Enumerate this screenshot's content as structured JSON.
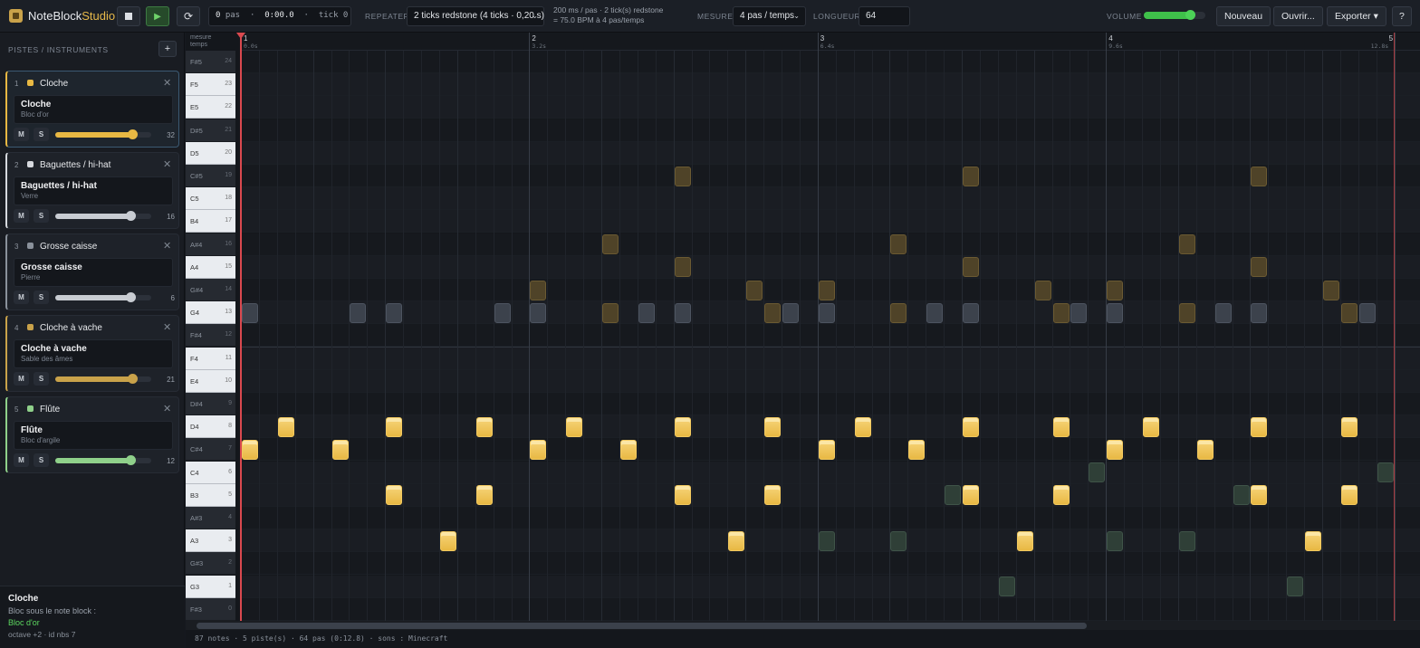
{
  "app": {
    "name_main": "NoteBlock",
    "name_accent": "Studio"
  },
  "transport": {
    "stop_icon": "stop-icon",
    "play_icon": "play-icon",
    "loop_icon": "loop-icon"
  },
  "position": {
    "steps_value": "0",
    "steps_unit": "pas",
    "time": "0:00.0",
    "tick_label": "tick",
    "tick_value": "0"
  },
  "repeater": {
    "label": "REPEATER",
    "value": "2 ticks redstone (4 ticks · 0,20 s)"
  },
  "timing_info": {
    "line1": "200 ms / pas · 2 tick(s) redstone",
    "line2": "= 75.0 BPM à 4 pas/temps"
  },
  "measure": {
    "label": "MESURE",
    "value": "4 pas / temps"
  },
  "length": {
    "label": "LONGUEUR",
    "value": "64"
  },
  "volume": {
    "label": "VOLUME",
    "level": 0.75
  },
  "actions": {
    "new": "Nouveau",
    "open": "Ouvrir...",
    "export": "Exporter ▾",
    "help": "?"
  },
  "sidebar": {
    "title": "PISTES / INSTRUMENTS",
    "add": "+",
    "tracks": [
      {
        "num": "1",
        "name": "Cloche",
        "instrument": "Cloche",
        "block": "Bloc d'or",
        "volume": "32",
        "level": 0.8,
        "color": "#e8b843",
        "selected": true
      },
      {
        "num": "2",
        "name": "Baguettes / hi-hat",
        "instrument": "Baguettes / hi-hat",
        "block": "Verre",
        "volume": "16",
        "level": 0.78,
        "color": "#d6d9de",
        "selected": false
      },
      {
        "num": "3",
        "name": "Grosse caisse",
        "instrument": "Grosse caisse",
        "block": "Pierre",
        "volume": "6",
        "level": 0.78,
        "color": "#8a919b",
        "selected": false
      },
      {
        "num": "4",
        "name": "Cloche à vache",
        "instrument": "Cloche à vache",
        "block": "Sable des âmes",
        "volume": "21",
        "level": 0.8,
        "color": "#c9a24a",
        "selected": false
      },
      {
        "num": "5",
        "name": "Flûte",
        "instrument": "Flûte",
        "block": "Bloc d'argile",
        "volume": "12",
        "level": 0.78,
        "color": "#8fd08a",
        "selected": false
      }
    ],
    "mute": "M",
    "solo": "S"
  },
  "info_panel": {
    "title": "Cloche",
    "line1": "Bloc sous le note block :",
    "block": "Bloc d'or",
    "details": "octave +2 · id nbs 7"
  },
  "editor": {
    "corner_top": "mesure",
    "corner_bottom": "temps",
    "measures": [
      {
        "label": "1",
        "time": "0.0s"
      },
      {
        "label": "2",
        "time": "3.2s"
      },
      {
        "label": "3",
        "time": "6.4s"
      },
      {
        "label": "4",
        "time": "9.6s"
      },
      {
        "label": "5",
        "time": "12.8s"
      }
    ],
    "keys": [
      {
        "note": "F#5",
        "index": "24"
      },
      {
        "note": "F5",
        "index": "23"
      },
      {
        "note": "E5",
        "index": "22"
      },
      {
        "note": "D#5",
        "index": "21"
      },
      {
        "note": "D5",
        "index": "20"
      },
      {
        "note": "C#5",
        "index": "19"
      },
      {
        "note": "C5",
        "index": "18"
      },
      {
        "note": "B4",
        "index": "17"
      },
      {
        "note": "A#4",
        "index": "16"
      },
      {
        "note": "A4",
        "index": "15"
      },
      {
        "note": "G#4",
        "index": "14"
      },
      {
        "note": "G4",
        "index": "13"
      },
      {
        "note": "F#4",
        "index": "12"
      },
      {
        "note": "F4",
        "index": "11"
      },
      {
        "note": "E4",
        "index": "10"
      },
      {
        "note": "D#4",
        "index": "9"
      },
      {
        "note": "D4",
        "index": "8"
      },
      {
        "note": "C#4",
        "index": "7"
      },
      {
        "note": "C4",
        "index": "6"
      },
      {
        "note": "B3",
        "index": "5"
      },
      {
        "note": "A#3",
        "index": "4"
      },
      {
        "note": "A3",
        "index": "3"
      },
      {
        "note": "G#3",
        "index": "2"
      },
      {
        "note": "G3",
        "index": "1"
      },
      {
        "note": "F#3",
        "index": "0"
      }
    ],
    "notes": [
      {
        "step": 0,
        "pitch": 7,
        "track": 1
      },
      {
        "step": 2,
        "pitch": 8,
        "track": 1
      },
      {
        "step": 5,
        "pitch": 7,
        "track": 1
      },
      {
        "step": 8,
        "pitch": 8,
        "track": 1
      },
      {
        "step": 8,
        "pitch": 5,
        "track": 1
      },
      {
        "step": 11,
        "pitch": 3,
        "track": 1
      },
      {
        "step": 13,
        "pitch": 8,
        "track": 1
      },
      {
        "step": 13,
        "pitch": 5,
        "track": 1
      },
      {
        "step": 16,
        "pitch": 7,
        "track": 1
      },
      {
        "step": 18,
        "pitch": 8,
        "track": 1
      },
      {
        "step": 21,
        "pitch": 7,
        "track": 1
      },
      {
        "step": 24,
        "pitch": 8,
        "track": 1
      },
      {
        "step": 24,
        "pitch": 5,
        "track": 1
      },
      {
        "step": 27,
        "pitch": 3,
        "track": 1
      },
      {
        "step": 29,
        "pitch": 8,
        "track": 1
      },
      {
        "step": 29,
        "pitch": 5,
        "track": 1
      },
      {
        "step": 32,
        "pitch": 7,
        "track": 1
      },
      {
        "step": 34,
        "pitch": 8,
        "track": 1
      },
      {
        "step": 37,
        "pitch": 7,
        "track": 1
      },
      {
        "step": 40,
        "pitch": 8,
        "track": 1
      },
      {
        "step": 40,
        "pitch": 5,
        "track": 1
      },
      {
        "step": 43,
        "pitch": 3,
        "track": 1
      },
      {
        "step": 45,
        "pitch": 8,
        "track": 1
      },
      {
        "step": 45,
        "pitch": 5,
        "track": 1
      },
      {
        "step": 48,
        "pitch": 7,
        "track": 1
      },
      {
        "step": 50,
        "pitch": 8,
        "track": 1
      },
      {
        "step": 53,
        "pitch": 7,
        "track": 1
      },
      {
        "step": 56,
        "pitch": 8,
        "track": 1
      },
      {
        "step": 56,
        "pitch": 5,
        "track": 1
      },
      {
        "step": 59,
        "pitch": 3,
        "track": 1
      },
      {
        "step": 61,
        "pitch": 8,
        "track": 1
      },
      {
        "step": 61,
        "pitch": 5,
        "track": 1
      },
      {
        "step": 0,
        "pitch": 13,
        "track": 2
      },
      {
        "step": 6,
        "pitch": 13,
        "track": 2
      },
      {
        "step": 8,
        "pitch": 13,
        "track": 2
      },
      {
        "step": 14,
        "pitch": 13,
        "track": 2
      },
      {
        "step": 16,
        "pitch": 13,
        "track": 2
      },
      {
        "step": 22,
        "pitch": 13,
        "track": 2
      },
      {
        "step": 24,
        "pitch": 13,
        "track": 2
      },
      {
        "step": 30,
        "pitch": 13,
        "track": 2
      },
      {
        "step": 32,
        "pitch": 13,
        "track": 2
      },
      {
        "step": 38,
        "pitch": 13,
        "track": 2
      },
      {
        "step": 40,
        "pitch": 13,
        "track": 2
      },
      {
        "step": 46,
        "pitch": 13,
        "track": 2
      },
      {
        "step": 48,
        "pitch": 13,
        "track": 2
      },
      {
        "step": 54,
        "pitch": 13,
        "track": 2
      },
      {
        "step": 56,
        "pitch": 13,
        "track": 2
      },
      {
        "step": 62,
        "pitch": 13,
        "track": 2
      },
      {
        "step": 16,
        "pitch": 14,
        "track": 4
      },
      {
        "step": 20,
        "pitch": 16,
        "track": 4
      },
      {
        "step": 20,
        "pitch": 13,
        "track": 4
      },
      {
        "step": 24,
        "pitch": 19,
        "track": 4
      },
      {
        "step": 24,
        "pitch": 15,
        "track": 4
      },
      {
        "step": 28,
        "pitch": 14,
        "track": 4
      },
      {
        "step": 29,
        "pitch": 13,
        "track": 4
      },
      {
        "step": 32,
        "pitch": 14,
        "track": 4
      },
      {
        "step": 36,
        "pitch": 16,
        "track": 4
      },
      {
        "step": 36,
        "pitch": 13,
        "track": 4
      },
      {
        "step": 40,
        "pitch": 19,
        "track": 4
      },
      {
        "step": 40,
        "pitch": 15,
        "track": 4
      },
      {
        "step": 44,
        "pitch": 14,
        "track": 4
      },
      {
        "step": 45,
        "pitch": 13,
        "track": 4
      },
      {
        "step": 48,
        "pitch": 14,
        "track": 4
      },
      {
        "step": 52,
        "pitch": 16,
        "track": 4
      },
      {
        "step": 52,
        "pitch": 13,
        "track": 4
      },
      {
        "step": 56,
        "pitch": 19,
        "track": 4
      },
      {
        "step": 56,
        "pitch": 15,
        "track": 4
      },
      {
        "step": 60,
        "pitch": 14,
        "track": 4
      },
      {
        "step": 61,
        "pitch": 13,
        "track": 4
      },
      {
        "step": 32,
        "pitch": 3,
        "track": 5
      },
      {
        "step": 36,
        "pitch": 3,
        "track": 5
      },
      {
        "step": 39,
        "pitch": 5,
        "track": 5
      },
      {
        "step": 42,
        "pitch": 1,
        "track": 5
      },
      {
        "step": 47,
        "pitch": 6,
        "track": 5
      },
      {
        "step": 48,
        "pitch": 3,
        "track": 5
      },
      {
        "step": 52,
        "pitch": 3,
        "track": 5
      },
      {
        "step": 55,
        "pitch": 5,
        "track": 5
      },
      {
        "step": 58,
        "pitch": 1,
        "track": 5
      },
      {
        "step": 63,
        "pitch": 6,
        "track": 5
      }
    ]
  },
  "status_bar": "87 notes · 5 piste(s) · 64 pas (0:12.8) · sons : Minecraft"
}
